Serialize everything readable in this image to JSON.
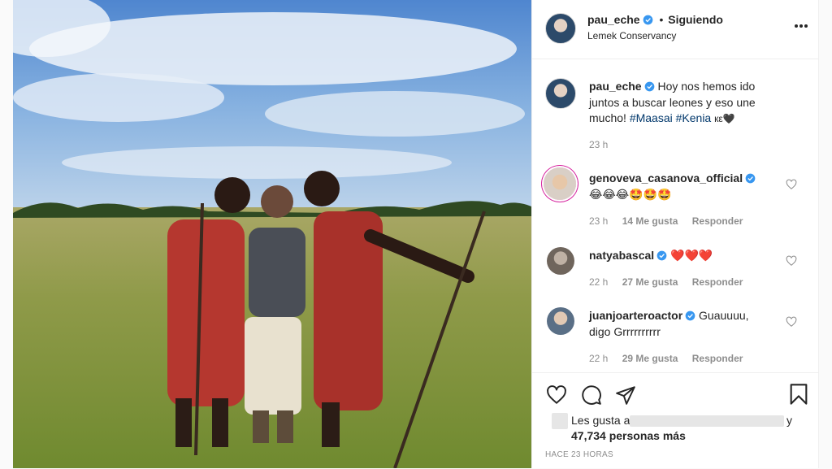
{
  "post": {
    "username": "pau_eche",
    "follow_status": "Siguiendo",
    "separator": "•",
    "location": "Lemek Conservancy",
    "caption": {
      "text": "Hoy nos hemos ido juntos a buscar leones y eso une mucho! ",
      "tags": [
        "#Maasai",
        "#Kenia"
      ],
      "suffix": "кε🖤",
      "time": "23 h"
    }
  },
  "comments": [
    {
      "username": "genoveva_casanova_official",
      "text": "😂😂😂🤩🤩🤩",
      "time": "23 h",
      "likes": "14 Me gusta",
      "reply": "Responder"
    },
    {
      "username": "natyabascal",
      "text": "❤️❤️❤️",
      "time": "22 h",
      "likes": "27 Me gusta",
      "reply": "Responder"
    },
    {
      "username": "juanjoarteroactor",
      "text": "Guauuuu, digo Grrrrrrrrrr",
      "time": "22 h",
      "likes": "29 Me gusta",
      "reply": "Responder"
    }
  ],
  "likes": {
    "prefix": "Les gusta a",
    "conj": "y",
    "count_text": "47,734 personas más"
  },
  "timestamp": "HACE 23 HORAS",
  "icons": [
    "more-options-icon",
    "verified-badge-icon",
    "heart-icon",
    "comment-icon",
    "share-icon",
    "bookmark-icon"
  ],
  "colors": {
    "accent_blue": "#3897f0",
    "link": "#00376b",
    "muted": "#8e8e8e",
    "heart_red": "#ed4956"
  }
}
